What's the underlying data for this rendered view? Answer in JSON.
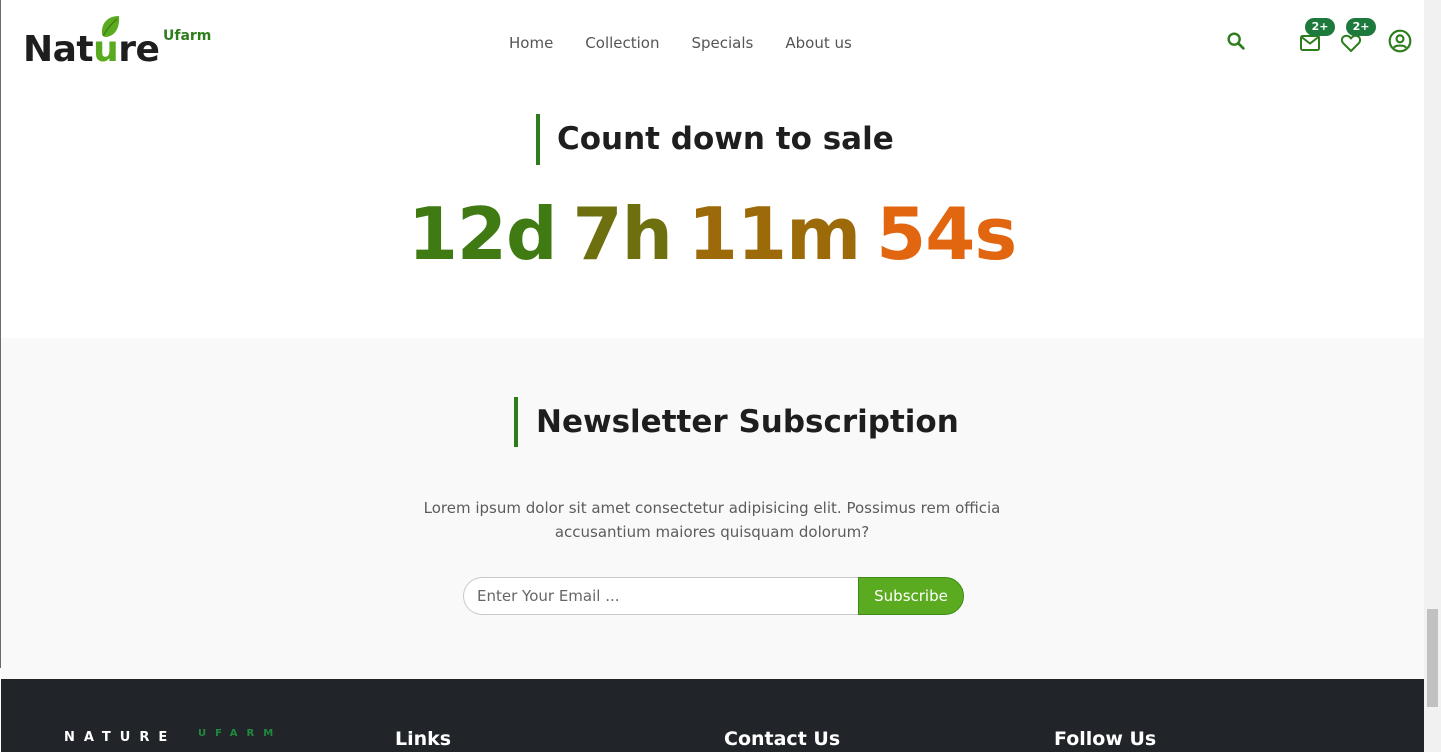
{
  "header": {
    "logo_text_pre": "Nat",
    "logo_text_u": "u",
    "logo_text_post": "re",
    "logo_sub": "Ufarm",
    "nav": [
      "Home",
      "Collection",
      "Specials",
      "About us"
    ],
    "mail_badge": "2+",
    "wishlist_badge": "2+",
    "icons": [
      "search-icon",
      "mail-icon",
      "heart-icon",
      "account-icon"
    ],
    "accent_color": "#2e7d1c"
  },
  "countdown": {
    "title": "Count down to sale",
    "days": "12d",
    "hours": "7h",
    "minutes": "11m",
    "seconds": "54s"
  },
  "newsletter": {
    "title": "Newsletter Subscription",
    "text": "Lorem ipsum dolor sit amet consectetur adipisicing elit. Possimus rem officia accusantium maiores quisquam dolorum?",
    "placeholder": "Enter Your Email ...",
    "button": "Subscribe",
    "button_color": "#5aab1f"
  },
  "footer": {
    "brand": "NATURE",
    "brand_sub": "UFARM",
    "links_heading": "Links",
    "contact_heading": "Contact Us",
    "follow_heading": "Follow Us",
    "background": "#212529"
  }
}
